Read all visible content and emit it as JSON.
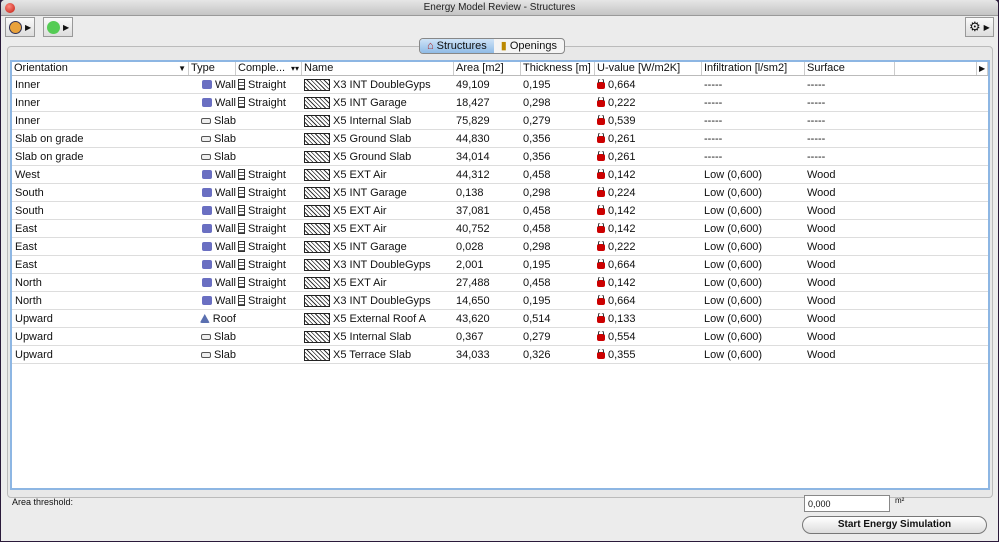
{
  "window": {
    "title": "Energy Model Review - Structures"
  },
  "tabs": [
    {
      "label": "Structures"
    },
    {
      "label": "Openings"
    }
  ],
  "columns": [
    "Orientation",
    "Type",
    "Comple...",
    "Name",
    "Area [m2]",
    "Thickness [m]",
    "U-value [W/m2K]",
    "Infiltration [l/sm2]",
    "Surface"
  ],
  "rows": [
    [
      "Inner",
      "Wall",
      "Straight",
      "X3 INT DoubleGyps",
      "49,109",
      "0,195",
      "0,664",
      "-----",
      "-----"
    ],
    [
      "Inner",
      "Wall",
      "Straight",
      "X5 INT Garage",
      "18,427",
      "0,298",
      "0,222",
      "-----",
      "-----"
    ],
    [
      "Inner",
      "Slab",
      "",
      "X5 Internal Slab",
      "75,829",
      "0,279",
      "0,539",
      "-----",
      "-----"
    ],
    [
      "Slab on grade",
      "Slab",
      "",
      "X5 Ground Slab",
      "44,830",
      "0,356",
      "0,261",
      "-----",
      "-----"
    ],
    [
      "Slab on grade",
      "Slab",
      "",
      "X5 Ground Slab",
      "34,014",
      "0,356",
      "0,261",
      "-----",
      "-----"
    ],
    [
      "West",
      "Wall",
      "Straight",
      "X5 EXT Air",
      "44,312",
      "0,458",
      "0,142",
      "Low (0,600)",
      "Wood"
    ],
    [
      "South",
      "Wall",
      "Straight",
      "X5 INT Garage",
      "0,138",
      "0,298",
      "0,224",
      "Low (0,600)",
      "Wood"
    ],
    [
      "South",
      "Wall",
      "Straight",
      "X5 EXT Air",
      "37,081",
      "0,458",
      "0,142",
      "Low (0,600)",
      "Wood"
    ],
    [
      "East",
      "Wall",
      "Straight",
      "X5 EXT Air",
      "40,752",
      "0,458",
      "0,142",
      "Low (0,600)",
      "Wood"
    ],
    [
      "East",
      "Wall",
      "Straight",
      "X5 INT Garage",
      "0,028",
      "0,298",
      "0,222",
      "Low (0,600)",
      "Wood"
    ],
    [
      "East",
      "Wall",
      "Straight",
      "X3 INT DoubleGyps",
      "2,001",
      "0,195",
      "0,664",
      "Low (0,600)",
      "Wood"
    ],
    [
      "North",
      "Wall",
      "Straight",
      "X5 EXT Air",
      "27,488",
      "0,458",
      "0,142",
      "Low (0,600)",
      "Wood"
    ],
    [
      "North",
      "Wall",
      "Straight",
      "X3 INT DoubleGyps",
      "14,650",
      "0,195",
      "0,664",
      "Low (0,600)",
      "Wood"
    ],
    [
      "Upward",
      "Roof",
      "",
      "X5 External Roof A",
      "43,620",
      "0,514",
      "0,133",
      "Low (0,600)",
      "Wood"
    ],
    [
      "Upward",
      "Slab",
      "",
      "X5 Internal Slab",
      "0,367",
      "0,279",
      "0,554",
      "Low (0,600)",
      "Wood"
    ],
    [
      "Upward",
      "Slab",
      "",
      "X5 Terrace Slab",
      "34,033",
      "0,326",
      "0,355",
      "Low (0,600)",
      "Wood"
    ]
  ],
  "footer": {
    "threshold_label": "Area threshold:",
    "threshold_value": "0,000",
    "unit": "m²",
    "start_button": "Start Energy Simulation"
  }
}
